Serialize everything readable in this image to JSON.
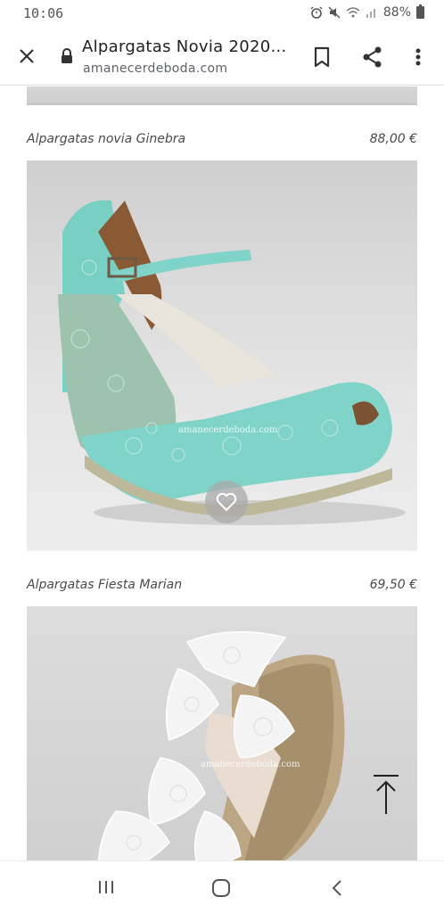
{
  "status_bar": {
    "time": "10:06",
    "battery_percent": "88%",
    "icons": [
      "alarm-icon",
      "mute-icon",
      "wifi-icon",
      "signal-icon",
      "battery-icon"
    ]
  },
  "toolbar": {
    "title": "Alpargatas Novia 2020...",
    "url": "amanecerdeboda.com",
    "icons": [
      "close-icon",
      "lock-icon",
      "bookmark-icon",
      "share-icon",
      "more-vert-icon"
    ]
  },
  "products": [
    {
      "name": "Alpargatas novia Ginebra",
      "price": "88,00 €",
      "watermark": "amanecerdeboda.com",
      "shoe_color": "#7fd3c8"
    },
    {
      "name": "Alpargatas Fiesta Marian",
      "price": "69,50 €",
      "watermark": "amanecerdeboda.com",
      "shoe_color": "#efefef"
    }
  ],
  "nav_bar": {
    "icons": [
      "recents-icon",
      "home-icon",
      "back-icon"
    ]
  },
  "colors": {
    "accent_teal": "#7fd3c8",
    "text_dark": "#202124",
    "text_muted": "#5f6368"
  }
}
